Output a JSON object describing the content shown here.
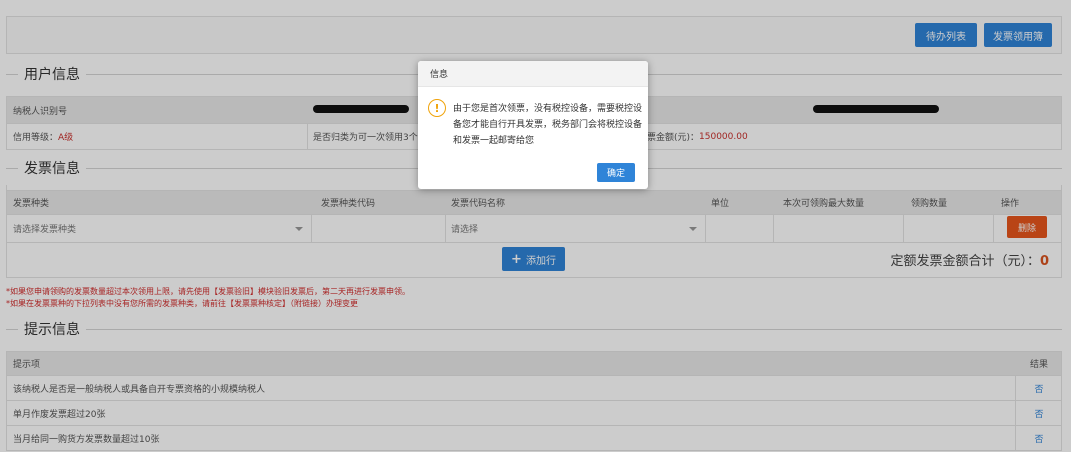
{
  "toolbar": {
    "todo_label": "待办列表",
    "invoice_label": "发票领用簿"
  },
  "user_info": {
    "title": "用户信息",
    "taxpayer_id_label": "纳税人识别号",
    "credit_label": "信用等级：",
    "credit_value": "A级",
    "category_text": "是否归类为可一次领用3个月",
    "amount_label": "票金额(元)：",
    "amount_value": "150000.00"
  },
  "invoice_info": {
    "title": "发票信息",
    "columns": [
      "发票种类",
      "发票种类代码",
      "发票代码名称",
      "单位",
      "本次可领购最大数量",
      "领购数量",
      "操作"
    ],
    "type_placeholder": "请选择发票种类",
    "code_placeholder": "请选择",
    "delete_label": "删除",
    "add_row_label": "添加行",
    "total_label": "定额发票金额合计（元）：",
    "total_value": "0"
  },
  "notes": [
    "*如果您申请领购的发票数量超过本次领用上限，请先使用【发票验旧】模块验旧发票后，第二天再进行发票申领。",
    "*如果在发票票种的下拉列表中没有您所需的发票种类，请前往【发票票种核定】（附链接）办理变更"
  ],
  "tips": {
    "title": "提示信息",
    "header_item": "提示项",
    "header_result": "结果",
    "rows": [
      {
        "item": "该纳税人是否是一般纳税人或具备自开专票资格的小规模纳税人",
        "result": "否"
      },
      {
        "item": "单月作废发票超过20张",
        "result": "否"
      },
      {
        "item": "当月给同一购货方发票数量超过10张",
        "result": "否"
      }
    ]
  },
  "dialog": {
    "title": "信息",
    "icon": "warning-icon",
    "message": "由于您是首次领票，没有税控设备，需要税控设备您才能自行开具发票，税务部门会将税控设备和发票一起邮寄给您",
    "ok_label": "确定"
  }
}
